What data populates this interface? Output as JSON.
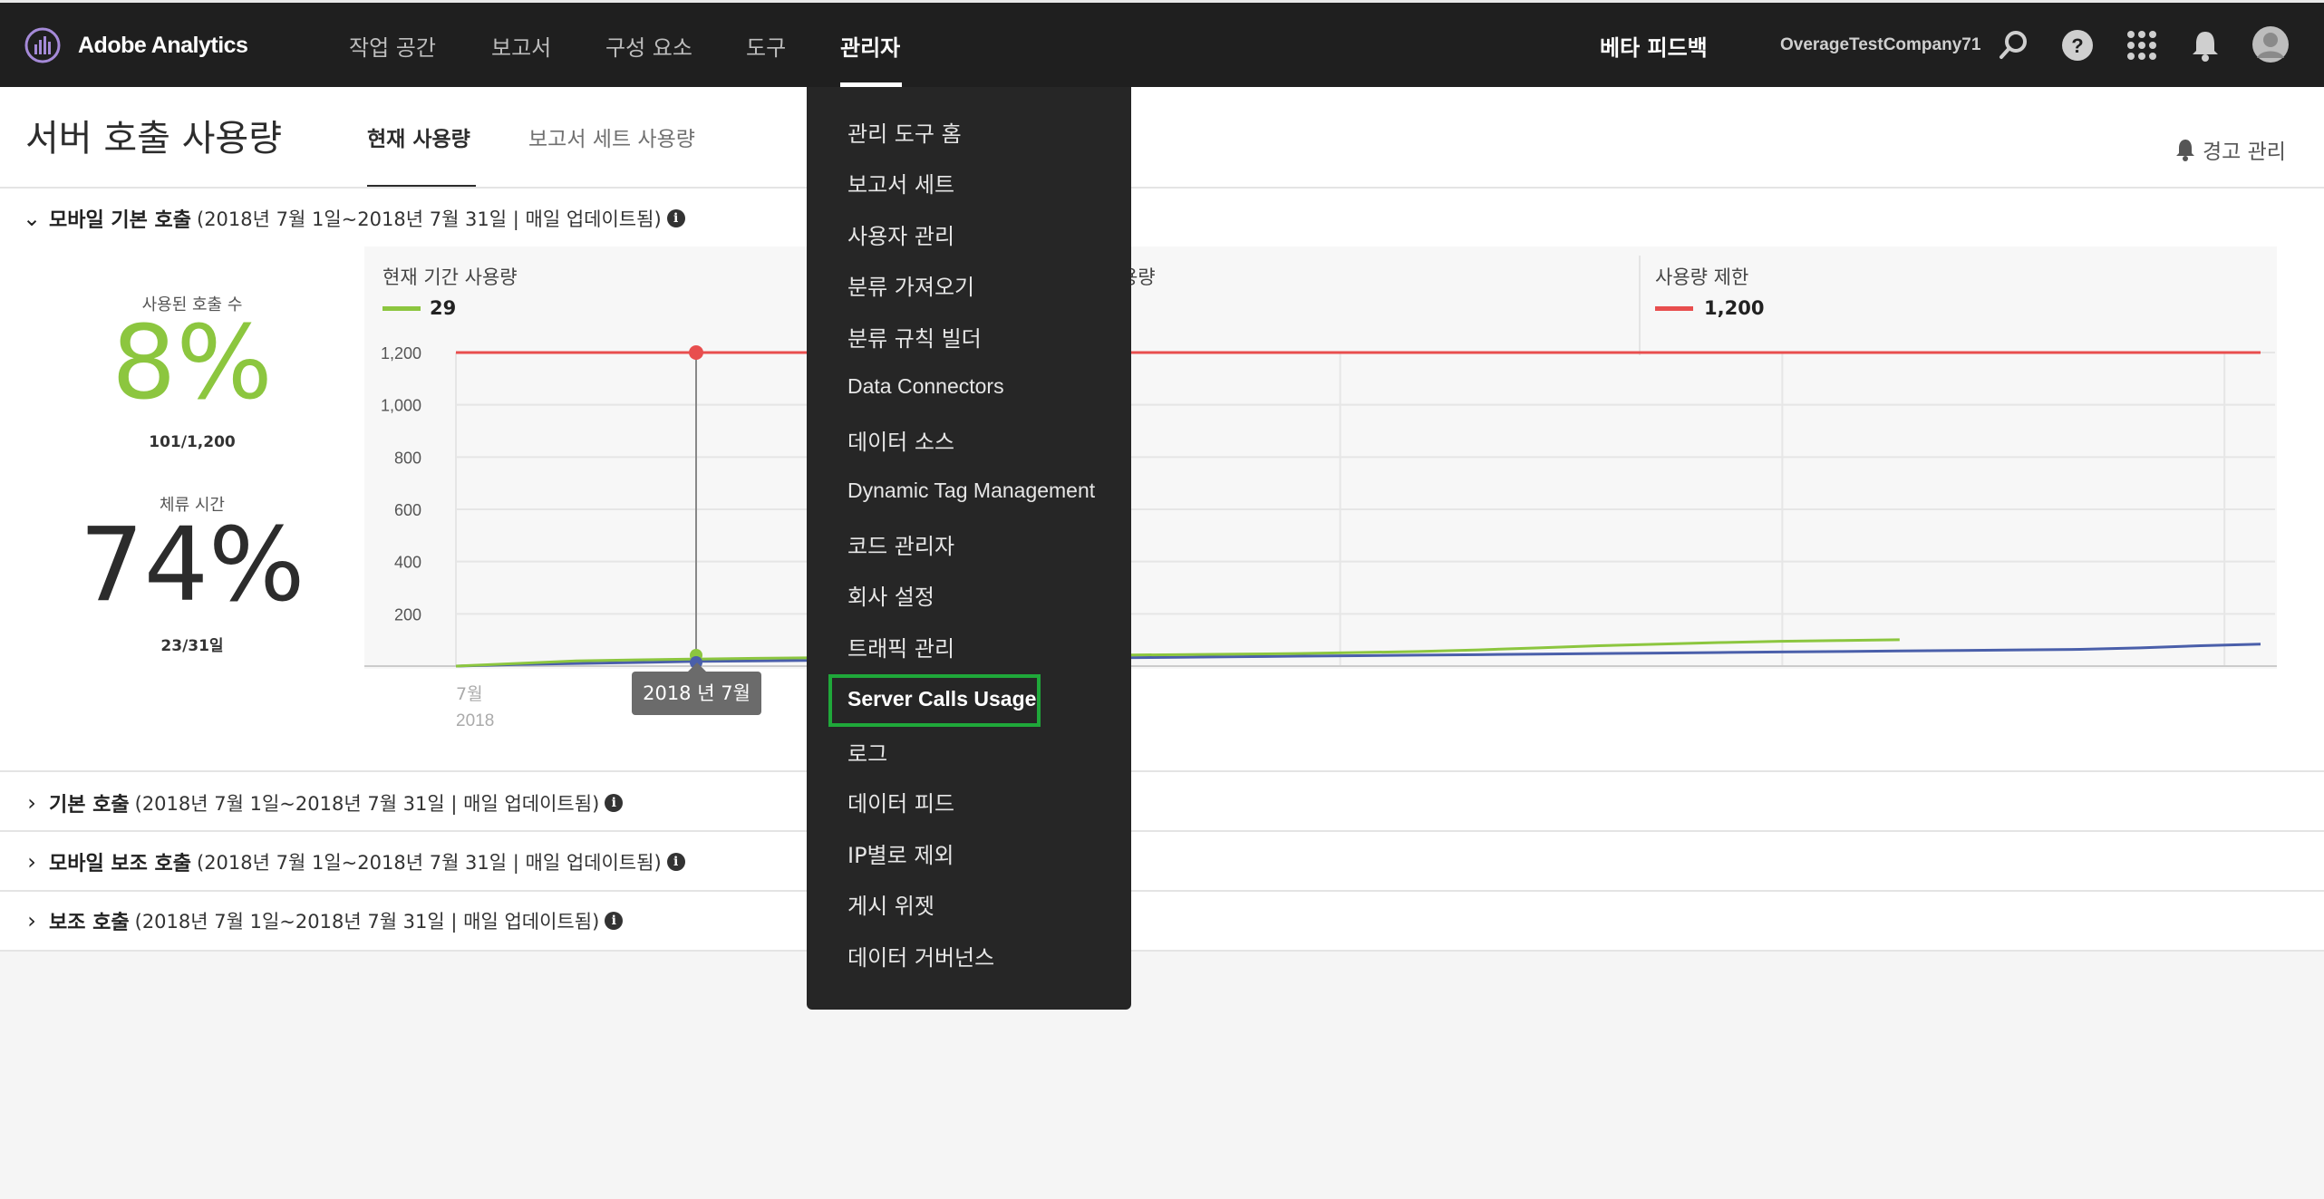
{
  "app": {
    "name": "Adobe Analytics"
  },
  "nav": {
    "items": [
      "작업 공간",
      "보고서",
      "구성 요소",
      "도구",
      "관리자"
    ],
    "active": "관리자"
  },
  "header": {
    "beta_feedback": "베타 피드백",
    "company": "OverageTestCompany71"
  },
  "page": {
    "title": "서버 호출 사용량",
    "tabs": [
      "현재 사용량",
      "보고서 세트 사용량"
    ],
    "alert_mgmt": "경고 관리"
  },
  "sections": [
    {
      "name": "모바일 기본 호출",
      "detail": "(2018년 7월 1일~2018년 7월 31일 | 매일 업데이트됨)"
    },
    {
      "name": "기본 호출",
      "detail": "(2018년 7월 1일~2018년 7월 31일 | 매일 업데이트됨)"
    },
    {
      "name": "모바일 보조 호출",
      "detail": "(2018년 7월 1일~2018년 7월 31일 | 매일 업데이트됨)"
    },
    {
      "name": "보조 호출",
      "detail": "(2018년 7월 1일~2018년 7월 31일 | 매일 업데이트됨)"
    }
  ],
  "stats": {
    "calls_used_label": "사용된 호출 수",
    "calls_used_pct": "8%",
    "calls_used_frac": "101/1,200",
    "time_label": "체류 시간",
    "time_pct": "74%",
    "time_frac": "23/31일"
  },
  "legend": {
    "current": {
      "label": "현재 기간 사용량",
      "value": "29"
    },
    "previous": {
      "label": "이전 기간 사용량"
    },
    "limit": {
      "label": "사용량 제한",
      "value": "1,200"
    }
  },
  "tooltip": "2018 년 7월",
  "x_axis": {
    "label1": "7월",
    "label2": "2018"
  },
  "colors": {
    "current": "#8cc63f",
    "previous": "#4a5faa",
    "limit": "#e84e4e",
    "highlight": "#1fa83a"
  },
  "dropdown": {
    "items": [
      "관리 도구 홈",
      "보고서 세트",
      "사용자 관리",
      "분류 가져오기",
      "분류 규칙 빌더",
      "Data Connectors",
      "데이터 소스",
      "Dynamic Tag Management",
      "코드 관리자",
      "회사 설정",
      "트래픽 관리",
      "Server Calls Usage",
      "로그",
      "데이터 피드",
      "IP별로 제외",
      "게시 위젯",
      "데이터 거버넌스"
    ],
    "highlighted": "Server Calls Usage"
  },
  "chart_data": {
    "type": "line",
    "yticks": [
      "1,200",
      "1,000",
      "800",
      "600",
      "400",
      "200"
    ],
    "ylim": [
      0,
      1200
    ],
    "x_days": 31,
    "series": [
      {
        "name": "현재 기간 사용량",
        "values": [
          0,
          10,
          20,
          24,
          27,
          30,
          32,
          34,
          36,
          38,
          40,
          42,
          44,
          46,
          48,
          52,
          56,
          62,
          70,
          78,
          84,
          90,
          95,
          98,
          101
        ]
      },
      {
        "name": "이전 기간 사용량",
        "values": [
          0,
          6,
          10,
          14,
          18,
          20,
          22,
          24,
          26,
          28,
          30,
          32,
          34,
          36,
          38,
          40,
          42,
          44,
          46,
          48,
          50,
          52,
          54,
          56,
          58,
          60,
          62,
          64,
          70,
          78,
          84
        ]
      },
      {
        "name": "사용량 제한",
        "values": [
          1200
        ]
      }
    ]
  }
}
